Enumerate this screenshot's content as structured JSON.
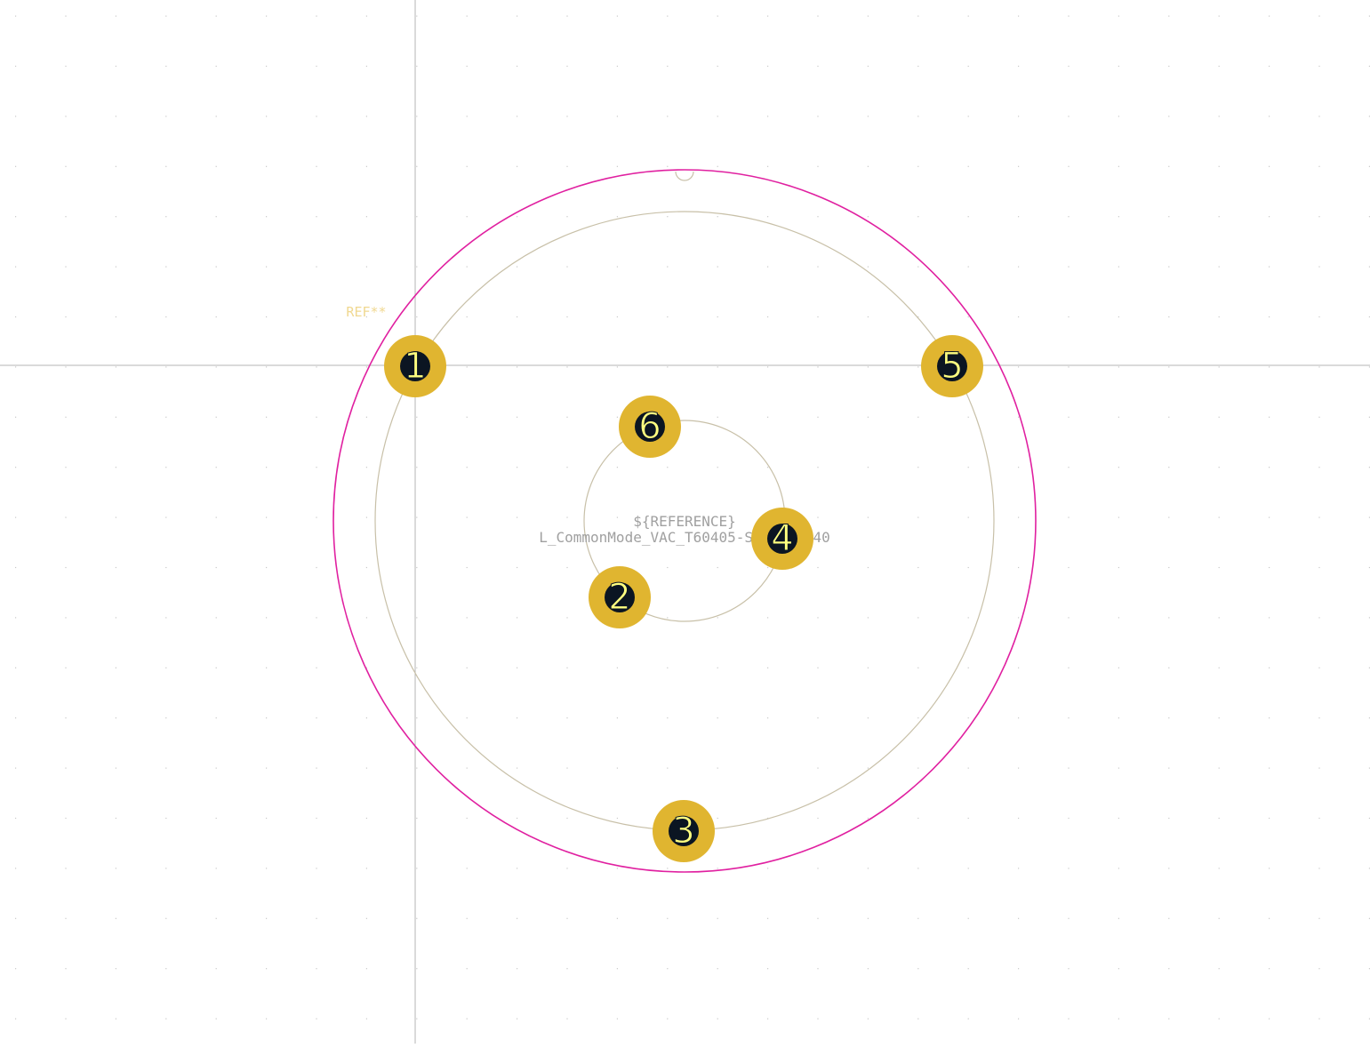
{
  "editor": {
    "name": "footprint-editor-canvas"
  },
  "footprint": {
    "reference_label": "REF**",
    "reference_field": "${REFERENCE}",
    "value_label": "L_CommonMode_VAC_T60405-S6123-X240"
  },
  "pads": [
    {
      "number": "1"
    },
    {
      "number": "2"
    },
    {
      "number": "3"
    },
    {
      "number": "4"
    },
    {
      "number": "5"
    },
    {
      "number": "6"
    }
  ],
  "colors": {
    "background": "#ffffff",
    "grid_dot": "#c8c8c8",
    "crosshair": "#b4b4b4",
    "courtyard": "#e020a0",
    "fab_outline": "#c8c0a8",
    "pad_copper": "#e0b530",
    "pad_hole": "#0b1522",
    "pad_number": "#ffff80",
    "reference_text": "#f0d890",
    "fab_text": "#a0a0a0"
  }
}
